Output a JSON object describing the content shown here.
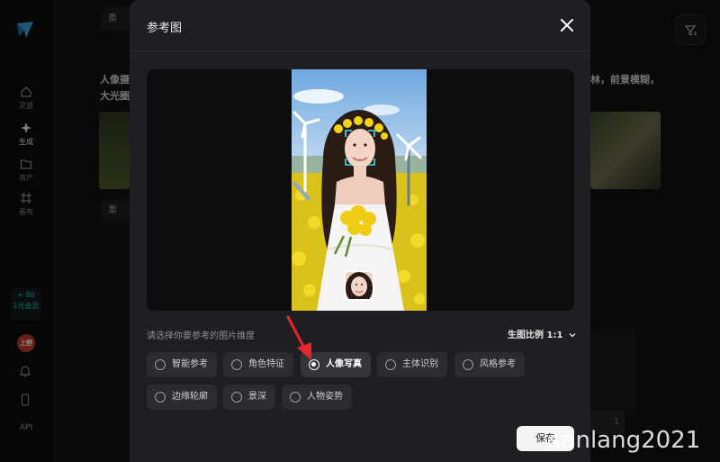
{
  "modal": {
    "title": "参考图",
    "prompt_label": "请选择你要参考的图片维度",
    "ratio_label": "生图比例 1:1",
    "save_label": "保存",
    "options": [
      {
        "label": "智能参考",
        "selected": false
      },
      {
        "label": "角色特征",
        "selected": false
      },
      {
        "label": "人像写真",
        "selected": true
      },
      {
        "label": "主体识别",
        "selected": false
      },
      {
        "label": "风格参考",
        "selected": false
      },
      {
        "label": "边缘轮廓",
        "selected": false
      },
      {
        "label": "景深",
        "selected": false
      },
      {
        "label": "人物姿势",
        "selected": false
      }
    ]
  },
  "sidebar": {
    "items": [
      {
        "label": "灵感",
        "icon": "home-icon"
      },
      {
        "label": "生成",
        "icon": "sparkle-icon"
      },
      {
        "label": "资产",
        "icon": "folder-icon"
      },
      {
        "label": "画布",
        "icon": "canvas-icon"
      }
    ],
    "credit_value": "+ 80",
    "credit_label": "1元会员",
    "avatar_text": "上野",
    "api_label": "API"
  },
  "background": {
    "chip_label": "重",
    "heading_left": "人像摄",
    "heading_left2": "大光圈",
    "heading_right": "林，前景模糊，",
    "like_count": "1"
  },
  "watermark": "sanlang2021",
  "colors": {
    "accent": "#26c6b4",
    "modal_bg": "#1f1f23",
    "option_bg": "#2b2b30",
    "arrow": "#e8242c"
  }
}
